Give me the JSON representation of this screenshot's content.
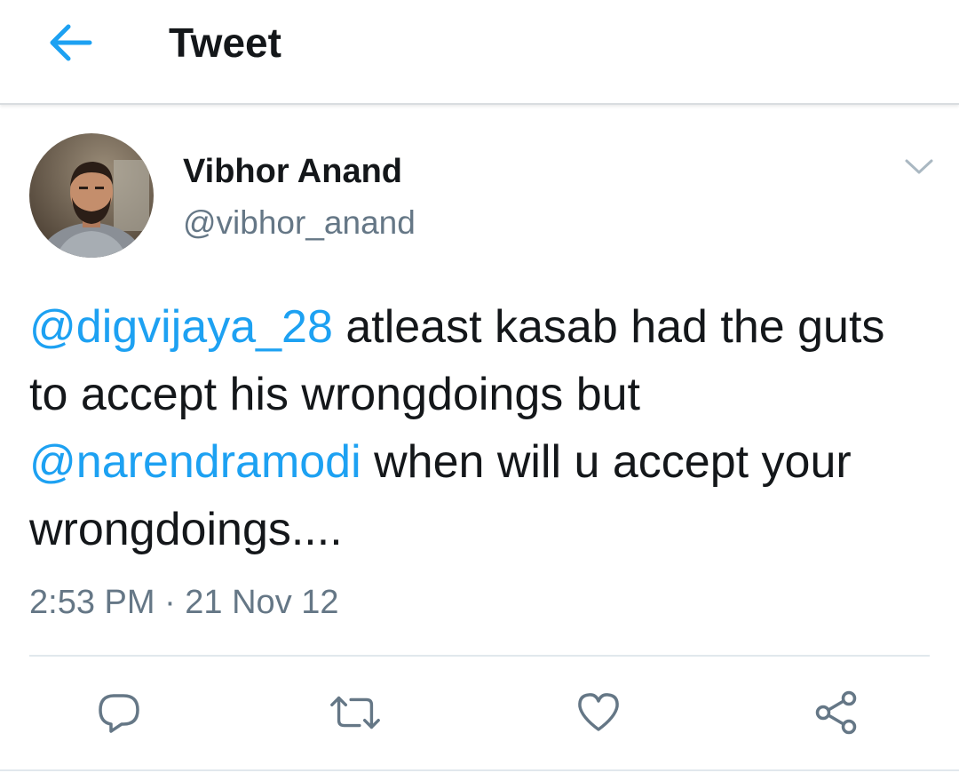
{
  "header": {
    "title": "Tweet",
    "back_icon": "arrow-left-icon"
  },
  "author": {
    "name": "Vibhor Anand",
    "handle": "@vibhor_anand",
    "avatar_icon": "user-photo-avatar",
    "menu_icon": "chevron-down-icon"
  },
  "tweet": {
    "mention1": "@digvijaya_28",
    "text1": " atleast kasab had the guts to accept his wrongdoings but ",
    "mention2": "@narendramodi",
    "text2": " when will u accept your wrongdoings....",
    "timestamp": "2:53 PM · 21 Nov 12"
  },
  "actions": {
    "reply_icon": "reply-icon",
    "retweet_icon": "retweet-icon",
    "like_icon": "heart-icon",
    "share_icon": "share-icon"
  },
  "colors": {
    "accent": "#1da1f2",
    "text": "#14171a",
    "secondary": "#657786",
    "divider": "#e1e8ed"
  }
}
